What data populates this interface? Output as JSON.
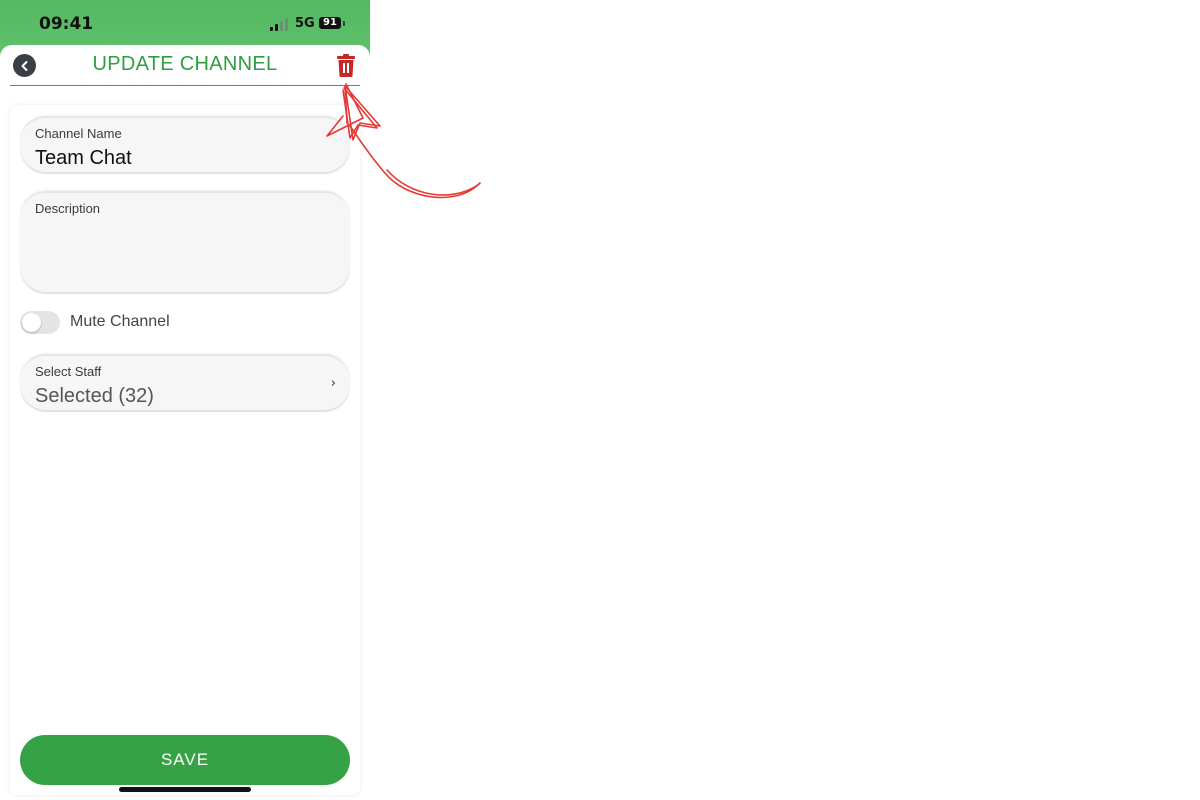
{
  "status_bar": {
    "time": "09:41",
    "network": "5G",
    "battery": "91"
  },
  "header": {
    "title": "UPDATE CHANNEL",
    "back_icon": "chevron-left-icon",
    "delete_icon": "trash-icon"
  },
  "form": {
    "channel_name": {
      "label": "Channel Name",
      "value": "Team Chat"
    },
    "description": {
      "label": "Description",
      "value": ""
    },
    "mute_toggle": {
      "label": "Mute Channel",
      "state": "off"
    },
    "select_staff": {
      "label": "Select Staff",
      "value": "Selected (32)"
    }
  },
  "actions": {
    "save_label": "SAVE"
  },
  "colors": {
    "brand_green": "#36a246",
    "title_green": "#2e9e42",
    "delete_red": "#c62828",
    "annotation_red": "#e53935"
  }
}
